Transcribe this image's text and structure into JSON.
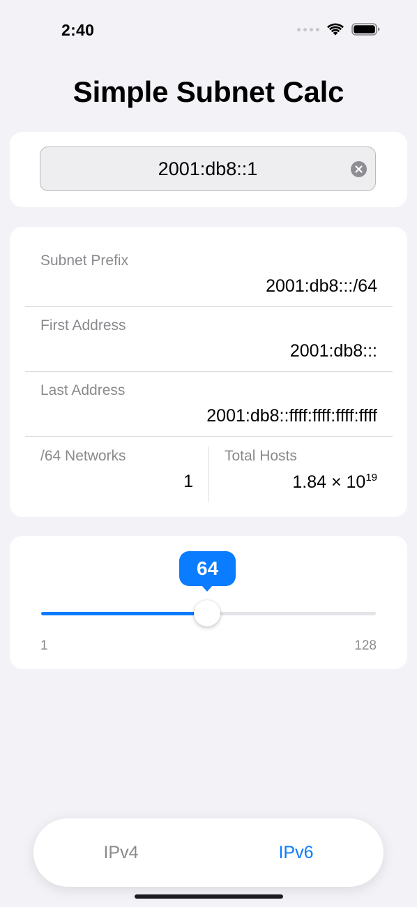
{
  "status_bar": {
    "time": "2:40",
    "icons": [
      "cellular-signal-icon",
      "wifi-icon",
      "battery-icon"
    ]
  },
  "app": {
    "title": "Simple Subnet Calc"
  },
  "address_input": {
    "value": "2001:db8::1",
    "clear_icon": "clear-circle-icon"
  },
  "results": {
    "subnet_prefix": {
      "label": "Subnet Prefix",
      "value": "2001:db8:::/64"
    },
    "first_address": {
      "label": "First Address",
      "value": "2001:db8:::"
    },
    "last_address": {
      "label": "Last Address",
      "value": "2001:db8::ffff:ffff:ffff:ffff"
    },
    "networks": {
      "label": "/64 Networks",
      "value": "1"
    },
    "total_hosts": {
      "label": "Total Hosts",
      "mantissa": "1.84 × 10",
      "exponent": "19"
    }
  },
  "prefix_slider": {
    "value": "64",
    "min_label": "1",
    "max_label": "128",
    "min": 1,
    "max": 128,
    "current": 64
  },
  "tabs": [
    {
      "label": "IPv4",
      "selected": false
    },
    {
      "label": "IPv6",
      "selected": true
    }
  ],
  "colors": {
    "accent": "#0a7cff",
    "background": "#f2f2f7",
    "secondary_text": "#8a8a8e"
  }
}
